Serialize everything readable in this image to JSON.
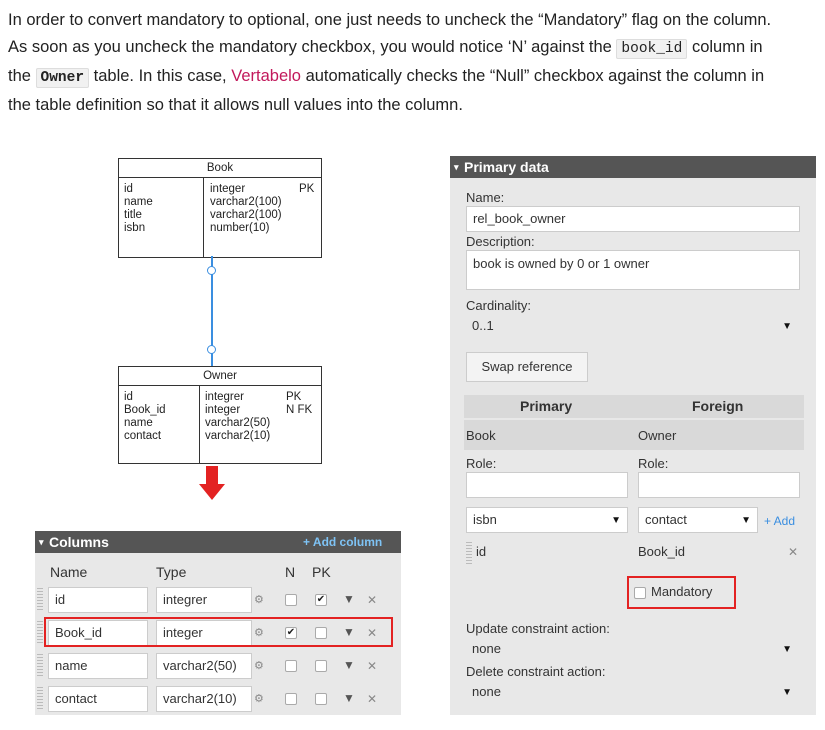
{
  "intro": {
    "p1": "In order to convert mandatory to optional, one just needs to uncheck the “Mandatory” flag on the column.",
    "p2": "As soon as you uncheck the mandatory checkbox, you would notice ‘N’ against the",
    "code1": "book_id",
    "p3": "column in",
    "p4": "the",
    "code2": "Owner",
    "p5": "table. In this case,",
    "link": "Vertabelo",
    "p6": "automatically checks the “Null” checkbox against the column in",
    "p7": "the table definition so that it allows null values into the column."
  },
  "er": {
    "book": {
      "title": "Book",
      "cols": [
        "id",
        "name",
        "title",
        "isbn"
      ],
      "types": [
        "integer",
        "varchar2(100)",
        "varchar2(100)",
        "number(10)"
      ],
      "keys": [
        "PK",
        "",
        "",
        ""
      ]
    },
    "owner": {
      "title": "Owner",
      "cols": [
        "id",
        "Book_id",
        "name",
        "contact"
      ],
      "types": [
        "integrer",
        "integer",
        "varchar2(50)",
        "varchar2(10)"
      ],
      "keys": [
        "PK",
        "N FK",
        "",
        ""
      ]
    }
  },
  "columns_panel": {
    "title": "Columns",
    "add_label": "+ Add column",
    "headers": {
      "name": "Name",
      "type": "Type",
      "n": "N",
      "pk": "PK"
    },
    "rows": [
      {
        "name": "id",
        "type": "integrer",
        "n": false,
        "pk": true
      },
      {
        "name": "Book_id",
        "type": "integer",
        "n": true,
        "pk": false
      },
      {
        "name": "name",
        "type": "varchar2(50)",
        "n": false,
        "pk": false
      },
      {
        "name": "contact",
        "type": "varchar2(10)",
        "n": false,
        "pk": false
      }
    ]
  },
  "primary_panel": {
    "title": "Primary data",
    "name_label": "Name:",
    "name_value": "rel_book_owner",
    "description_label": "Description:",
    "description_value": "book is owned by 0 or 1 owner",
    "cardinality_label": "Cardinality:",
    "cardinality_value": "0..1",
    "swap_label": "Swap reference",
    "primary_header": "Primary",
    "foreign_header": "Foreign",
    "primary_table": "Book",
    "foreign_table": "Owner",
    "role_label_primary": "Role:",
    "role_label_foreign": "Role:",
    "primary_col_select": "isbn",
    "foreign_col_select": "contact",
    "add_label": "+ Add",
    "pair_primary": "id",
    "pair_foreign": "Book_id",
    "mandatory_label": "Mandatory",
    "mandatory_checked": false,
    "update_label": "Update constraint action:",
    "update_value": "none",
    "delete_label": "Delete constraint action:",
    "delete_value": "none"
  },
  "icons": [
    "gear-icon",
    "chevron-down-icon",
    "close-icon",
    "arrow-down-icon",
    "caret-down-icon"
  ],
  "colors": {
    "highlight": "#e32222",
    "link": "#c2185b",
    "connector": "#3a8ee0",
    "panel_header": "#555555"
  }
}
